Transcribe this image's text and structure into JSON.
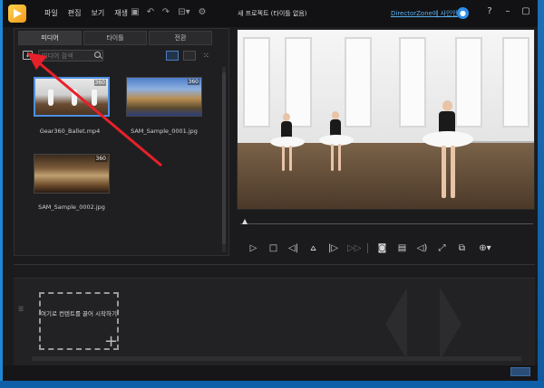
{
  "app": {
    "menu": [
      "파일",
      "편집",
      "보기",
      "재생"
    ],
    "title": "새 프로젝트 (타이틀 없음)",
    "signin_link": "DirectorZone에 사인인",
    "window_controls": [
      "?",
      "–",
      "▢",
      "✕"
    ]
  },
  "toolbar_icons": [
    "save-icon",
    "undo-icon",
    "redo-icon",
    "resize-icon",
    "settings-icon"
  ],
  "media": {
    "tabs": [
      {
        "label": "미디어",
        "active": true
      },
      {
        "label": "타이틀",
        "active": false
      },
      {
        "label": "전환",
        "active": false
      }
    ],
    "search": {
      "placeholder": "미디어 검색"
    },
    "items": [
      {
        "filename": "Gear360_Ballet.mp4",
        "badge": "360",
        "selected": true
      },
      {
        "filename": "SAM_Sample_0001.jpg",
        "badge": "360",
        "selected": false
      },
      {
        "filename": "SAM_Sample_0002.jpg",
        "badge": "360",
        "selected": false
      }
    ]
  },
  "player": {
    "controls": [
      "play-icon",
      "stop-icon",
      "prev-frame-icon",
      "split-icon",
      "next-frame-icon",
      "fast-forward-icon",
      "snapshot-icon",
      "subtitle-icon",
      "volume-icon",
      "fullscreen-icon",
      "detach-icon",
      "360-view-icon"
    ]
  },
  "timeline": {
    "drop_hint": "여기로 컨텐트를 끌어 시작하기"
  },
  "annotation": {
    "color": "#e8202a"
  }
}
